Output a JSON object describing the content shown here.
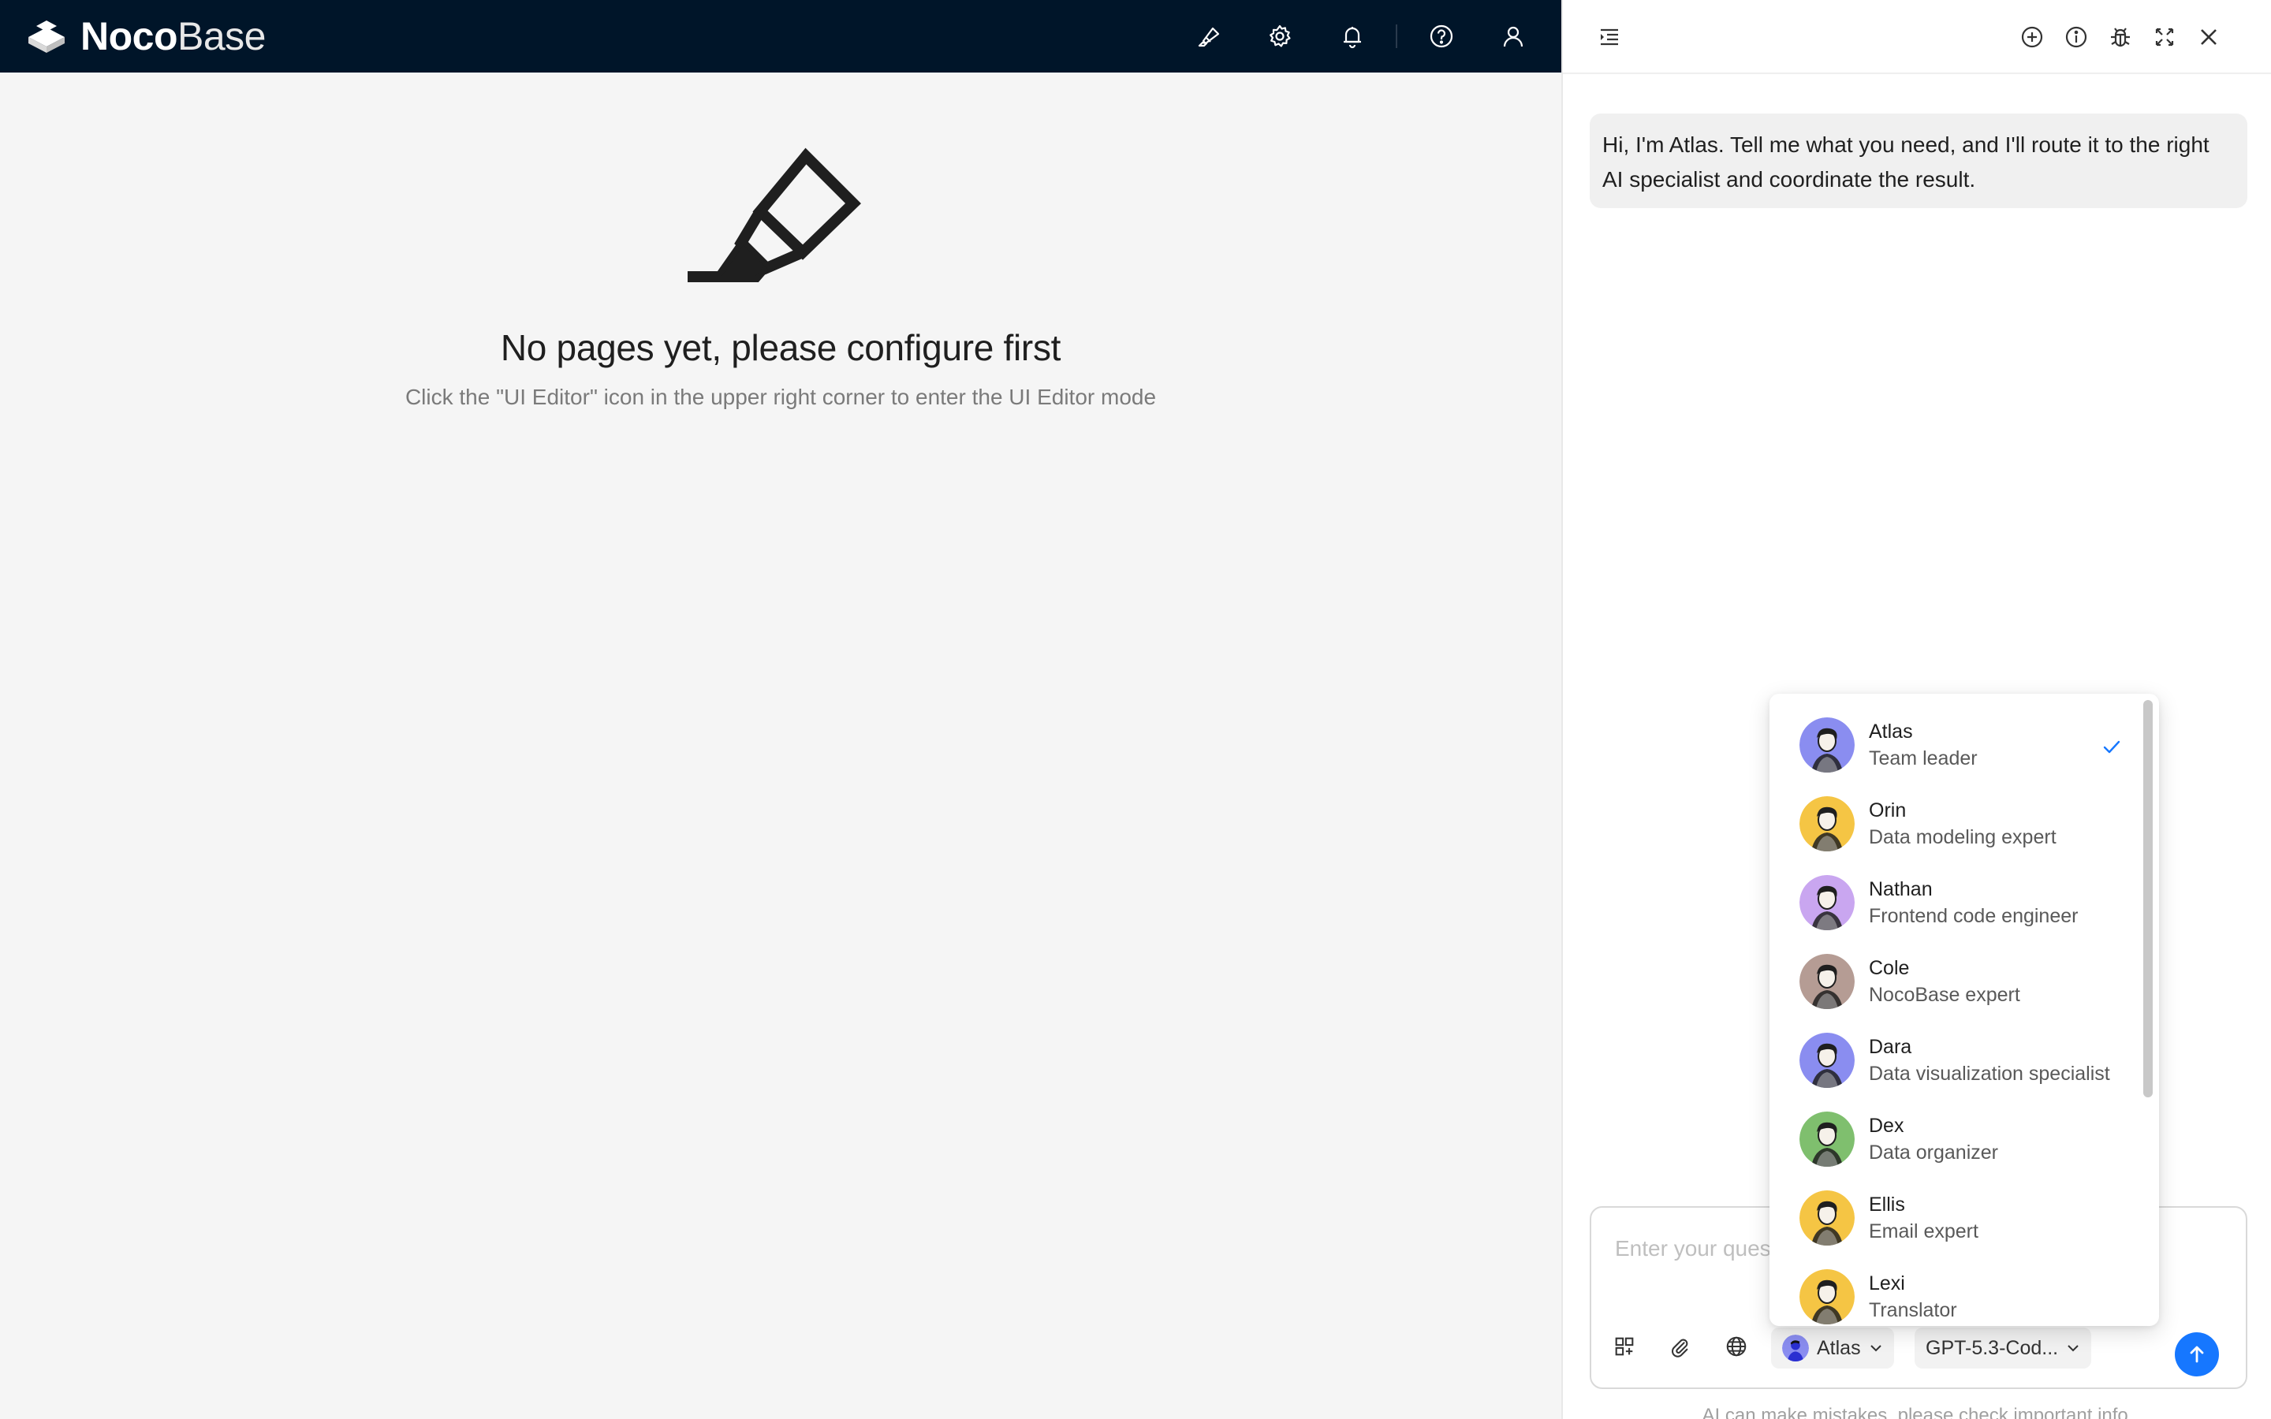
{
  "app": {
    "brand_bold": "Noco",
    "brand_light": "Base",
    "header_icons": [
      "ui-editor-icon",
      "settings-icon",
      "bell-icon",
      "help-icon",
      "user-icon"
    ]
  },
  "empty_state": {
    "title": "No pages yet, please configure first",
    "description": "Click the \"UI Editor\" icon in the upper right corner to enter the UI Editor mode"
  },
  "panel": {
    "header_icons": [
      "collapse-list-icon",
      "new-chat-icon",
      "info-icon",
      "debug-icon",
      "expand-icon",
      "close-icon"
    ],
    "message": "Hi, I'm Atlas. Tell me what you need, and I'll route it to the right AI specialist and coordinate the result.",
    "input_placeholder": "Enter your ques",
    "selected_agent": "Atlas",
    "model": "GPT-5.3-Cod...",
    "disclaimer": "AI can make mistakes, please check important info."
  },
  "agents": [
    {
      "name": "Atlas",
      "role": "Team leader",
      "selected": true,
      "color": "#8a8df0"
    },
    {
      "name": "Orin",
      "role": "Data modeling expert",
      "selected": false,
      "color": "#f5c544"
    },
    {
      "name": "Nathan",
      "role": "Frontend code engineer",
      "selected": false,
      "color": "#c9a6f0"
    },
    {
      "name": "Cole",
      "role": "NocoBase expert",
      "selected": false,
      "color": "#b59c94"
    },
    {
      "name": "Dara",
      "role": "Data visualization specialist",
      "selected": false,
      "color": "#8a8df0"
    },
    {
      "name": "Dex",
      "role": "Data organizer",
      "selected": false,
      "color": "#7fbf6e"
    },
    {
      "name": "Ellis",
      "role": "Email expert",
      "selected": false,
      "color": "#f5c544"
    },
    {
      "name": "Lexi",
      "role": "Translator",
      "selected": false,
      "color": "#f5c544"
    }
  ],
  "colors": {
    "topbar": "#001529",
    "accent": "#1677ff",
    "background": "#f5f5f5"
  }
}
